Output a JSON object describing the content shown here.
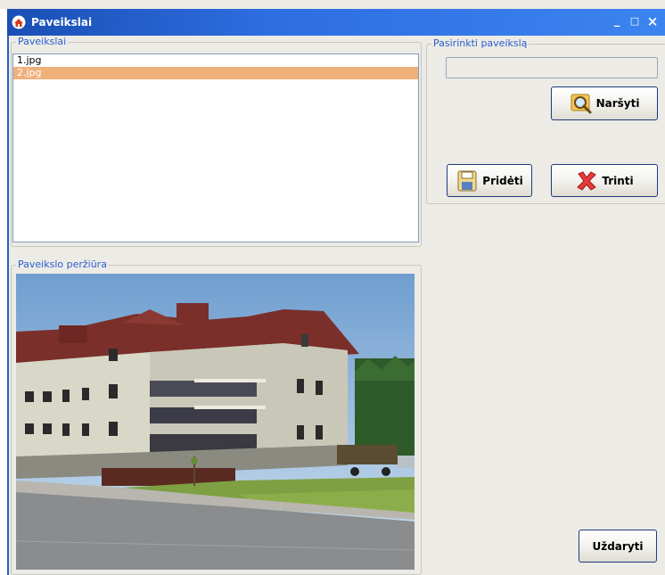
{
  "window": {
    "title": "Paveikslai",
    "controls": {
      "minimize": "_",
      "maximize": "□",
      "close": "×"
    }
  },
  "images_group": {
    "legend": "Paveikslai",
    "items": [
      {
        "label": "1.jpg",
        "selected": false
      },
      {
        "label": "2.jpg",
        "selected": true
      }
    ]
  },
  "select_group": {
    "legend": "Pasirinkti paveikslą",
    "path_value": "",
    "browse_label": "Naršyti",
    "add_label": "Pridėti",
    "delete_label": "Trinti"
  },
  "preview_group": {
    "legend": "Paveikslo peržiūra"
  },
  "close_label": "Uždaryti",
  "colors": {
    "title_bar": "#2d6ee0",
    "selection": "#f0b07a",
    "legend_text": "#2a5fcf",
    "button_border": "#1e3b7a"
  }
}
